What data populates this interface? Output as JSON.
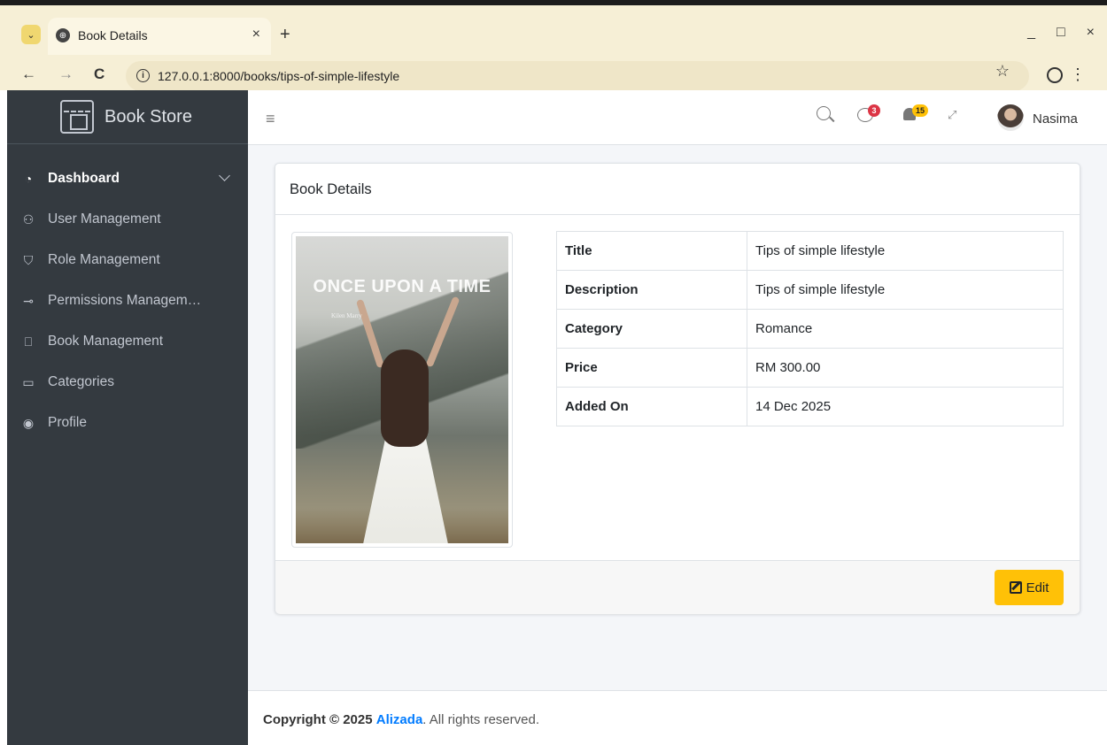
{
  "browser": {
    "tab_title": "Book Details",
    "tab_close": "×",
    "new_tab": "+",
    "url": "127.0.0.1:8000/books/tips-of-simple-lifestyle",
    "back": "←",
    "forward": "→",
    "reload": "C",
    "star": "☆",
    "menu": "⋮",
    "minimize": "_",
    "maximize": "□",
    "close": "×"
  },
  "brand": {
    "name": "Book Store"
  },
  "sidebar": {
    "items": [
      {
        "label": "Dashboard",
        "icon": "gauge-icon",
        "glyph": "◔"
      },
      {
        "label": "User Management",
        "icon": "users-icon",
        "glyph": "⚇"
      },
      {
        "label": "Role Management",
        "icon": "shield-icon",
        "glyph": "⛉"
      },
      {
        "label": "Permissions Managem…",
        "icon": "key-icon",
        "glyph": "⊸"
      },
      {
        "label": "Book Management",
        "icon": "book-icon",
        "glyph": "⎕"
      },
      {
        "label": "Categories",
        "icon": "folder-icon",
        "glyph": "▭"
      },
      {
        "label": "Profile",
        "icon": "user-circle-icon",
        "glyph": "◉"
      }
    ]
  },
  "topnav": {
    "hamburger": "≡",
    "messages_count": "3",
    "notifications_count": "15",
    "fullscreen": "⤢",
    "user_name": "Nasima"
  },
  "card": {
    "title": "Book Details",
    "cover": {
      "title": "ONCE UPON A TIME",
      "author": "Kilen Marry"
    },
    "details": [
      {
        "label": "Title",
        "value": "Tips of simple lifestyle"
      },
      {
        "label": "Description",
        "value": "Tips of simple lifestyle"
      },
      {
        "label": "Category",
        "value": "Romance"
      },
      {
        "label": "Price",
        "value": "RM 300.00"
      },
      {
        "label": "Added On",
        "value": "14 Dec 2025"
      }
    ],
    "edit_label": "Edit"
  },
  "footer": {
    "prefix": "Copyright © 2025",
    "company": "Alizada",
    "suffix": ". All rights reserved."
  },
  "colors": {
    "sidebar_bg": "#343a40",
    "accent": "#007bff",
    "edit_button": "#ffc107",
    "badge_red": "#dc3545",
    "badge_yellow": "#ffc107"
  }
}
